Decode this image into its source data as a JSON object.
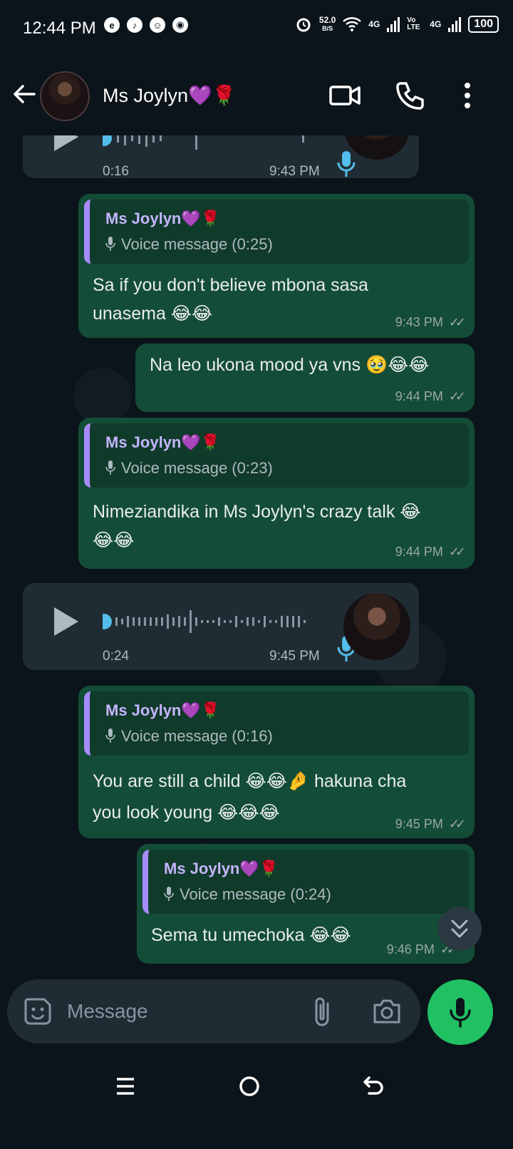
{
  "status_bar": {
    "time": "12:44 PM",
    "speed_value": "52.0",
    "speed_unit": "B/S",
    "net1": "4G",
    "volte": "Vo LTE",
    "net2": "4G",
    "battery": "100"
  },
  "header": {
    "contact_name": "Ms Joylyn💜🌹"
  },
  "messages": [
    {
      "type": "voice_in",
      "duration": "0:16",
      "time": "9:43 PM"
    },
    {
      "type": "reply_out",
      "quote_name": "Ms Joylyn💜🌹",
      "quote_sub": "Voice message (0:25)",
      "text1": "Sa if you don't believe mbona sasa",
      "text2": "unasema 😂😂",
      "time": "9:43 PM"
    },
    {
      "type": "out",
      "text1": "Na leo ukona mood ya vns 🥹😂😂",
      "time": "9:44 PM"
    },
    {
      "type": "reply_out",
      "quote_name": "Ms Joylyn💜🌹",
      "quote_sub": "Voice message (0:23)",
      "text1": "Nimeziandika in Ms Joylyn's crazy talk 😂",
      "text2": "😂😂",
      "time": "9:44 PM"
    },
    {
      "type": "voice_in",
      "duration": "0:24",
      "time": "9:45 PM"
    },
    {
      "type": "reply_out",
      "quote_name": "Ms Joylyn💜🌹",
      "quote_sub": "Voice message (0:16)",
      "text1": "You are still a child 😂😂🤌 hakuna cha",
      "text2": "you look young 😂😂😂",
      "time": "9:45 PM"
    },
    {
      "type": "reply_out",
      "quote_name": "Ms Joylyn💜🌹",
      "quote_sub": "Voice message (0:24)",
      "text1": "Sema tu umechoka 😂😂",
      "time": "9:46 PM"
    }
  ],
  "input": {
    "placeholder": "Message"
  },
  "colors": {
    "outgoing_bubble": "#144d37",
    "incoming_bubble": "#202c33",
    "accent_green": "#21c063",
    "quote_bar": "#a78bfa"
  }
}
